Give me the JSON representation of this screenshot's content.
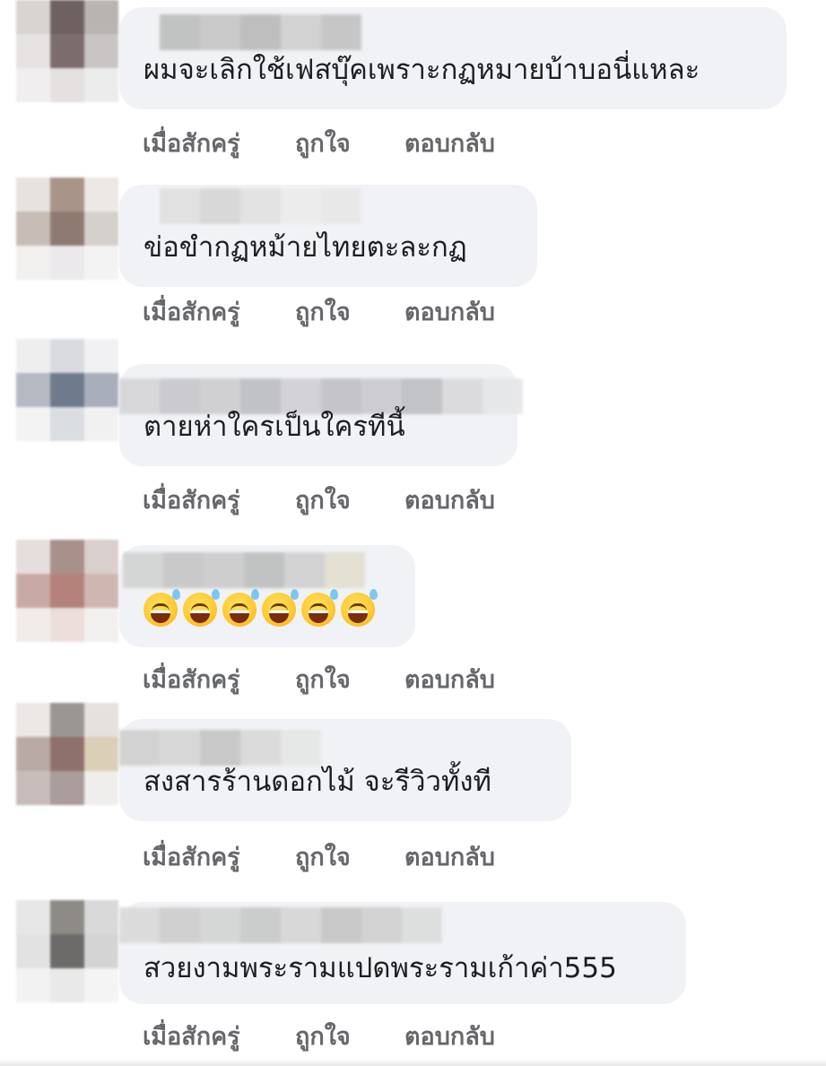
{
  "actions": {
    "time": "เมื่อสักครู่",
    "like": "ถูกใจ",
    "reply": "ตอบกลับ"
  },
  "comments": [
    {
      "text": "ผมจะเลิกใช้เฟสบุ๊คเพราะกฏหมายบ้าบอนี่แหละ"
    },
    {
      "text": "ข่อขำกฏหม้ายไทยตะละกฏ"
    },
    {
      "text": "ตายห่าใครเป็นใครทีนี้"
    },
    {
      "emoji": [
        "grinning-sweat-emoji",
        "grinning-sweat-emoji",
        "grinning-sweat-emoji",
        "grinning-sweat-emoji",
        "grinning-sweat-emoji",
        "grinning-sweat-emoji"
      ]
    },
    {
      "text": "สงสารร้านดอกไม้   จะรีวิวทั้งที"
    },
    {
      "text": "สวยงามพระรามแปดพระรามเก้าค่า555"
    }
  ],
  "colors": {
    "bubble": "#f0f2f5",
    "text": "#1c1e21",
    "action_text": "#65676b"
  }
}
